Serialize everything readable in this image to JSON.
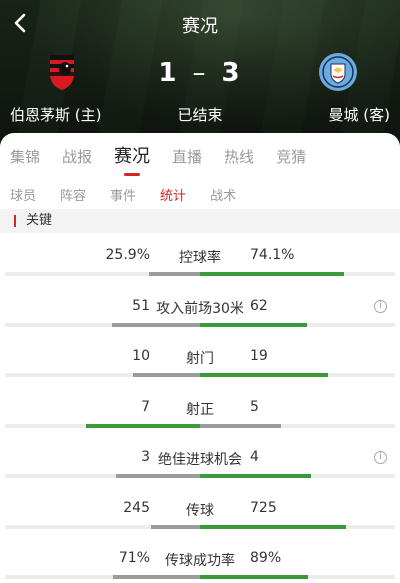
{
  "header": {
    "title": "赛况",
    "home_team": "伯恩茅斯 (主)",
    "away_team": "曼城 (客)",
    "home_score": "1",
    "separator": "–",
    "away_score": "3",
    "status": "已结束",
    "home_crest": "bournemouth-crest-icon",
    "away_crest": "manchester-city-crest-icon"
  },
  "main_tabs": [
    {
      "label": "集锦",
      "active": false
    },
    {
      "label": "战报",
      "active": false
    },
    {
      "label": "赛况",
      "active": true
    },
    {
      "label": "直播",
      "active": false
    },
    {
      "label": "热线",
      "active": false
    },
    {
      "label": "竞猜",
      "active": false
    }
  ],
  "sub_tabs": [
    {
      "label": "球员",
      "active": false
    },
    {
      "label": "阵容",
      "active": false
    },
    {
      "label": "事件",
      "active": false
    },
    {
      "label": "统计",
      "active": true
    },
    {
      "label": "战术",
      "active": false
    }
  ],
  "section": {
    "title": "关键"
  },
  "stats": [
    {
      "label": "控球率",
      "home": "25.9%",
      "away": "74.1%",
      "home_share": 0.259,
      "away_share": 0.741,
      "info": false
    },
    {
      "label": "攻入前场30米",
      "home": "51",
      "away": "62",
      "home_share": 0.45,
      "away_share": 0.55,
      "info": true
    },
    {
      "label": "射门",
      "home": "10",
      "away": "19",
      "home_share": 0.345,
      "away_share": 0.655,
      "info": false
    },
    {
      "label": "射正",
      "home": "7",
      "away": "5",
      "home_share": 0.583,
      "away_share": 0.417,
      "info": false
    },
    {
      "label": "绝佳进球机会",
      "home": "3",
      "away": "4",
      "home_share": 0.429,
      "away_share": 0.571,
      "info": true
    },
    {
      "label": "传球",
      "home": "245",
      "away": "725",
      "home_share": 0.253,
      "away_share": 0.747,
      "info": false
    },
    {
      "label": "传球成功率",
      "home": "71%",
      "away": "89%",
      "home_share": 0.444,
      "away_share": 0.556,
      "info": false
    }
  ],
  "colors": {
    "accent": "#d8232a",
    "win": "#3a9a3a",
    "lose": "#9b9b9b"
  }
}
